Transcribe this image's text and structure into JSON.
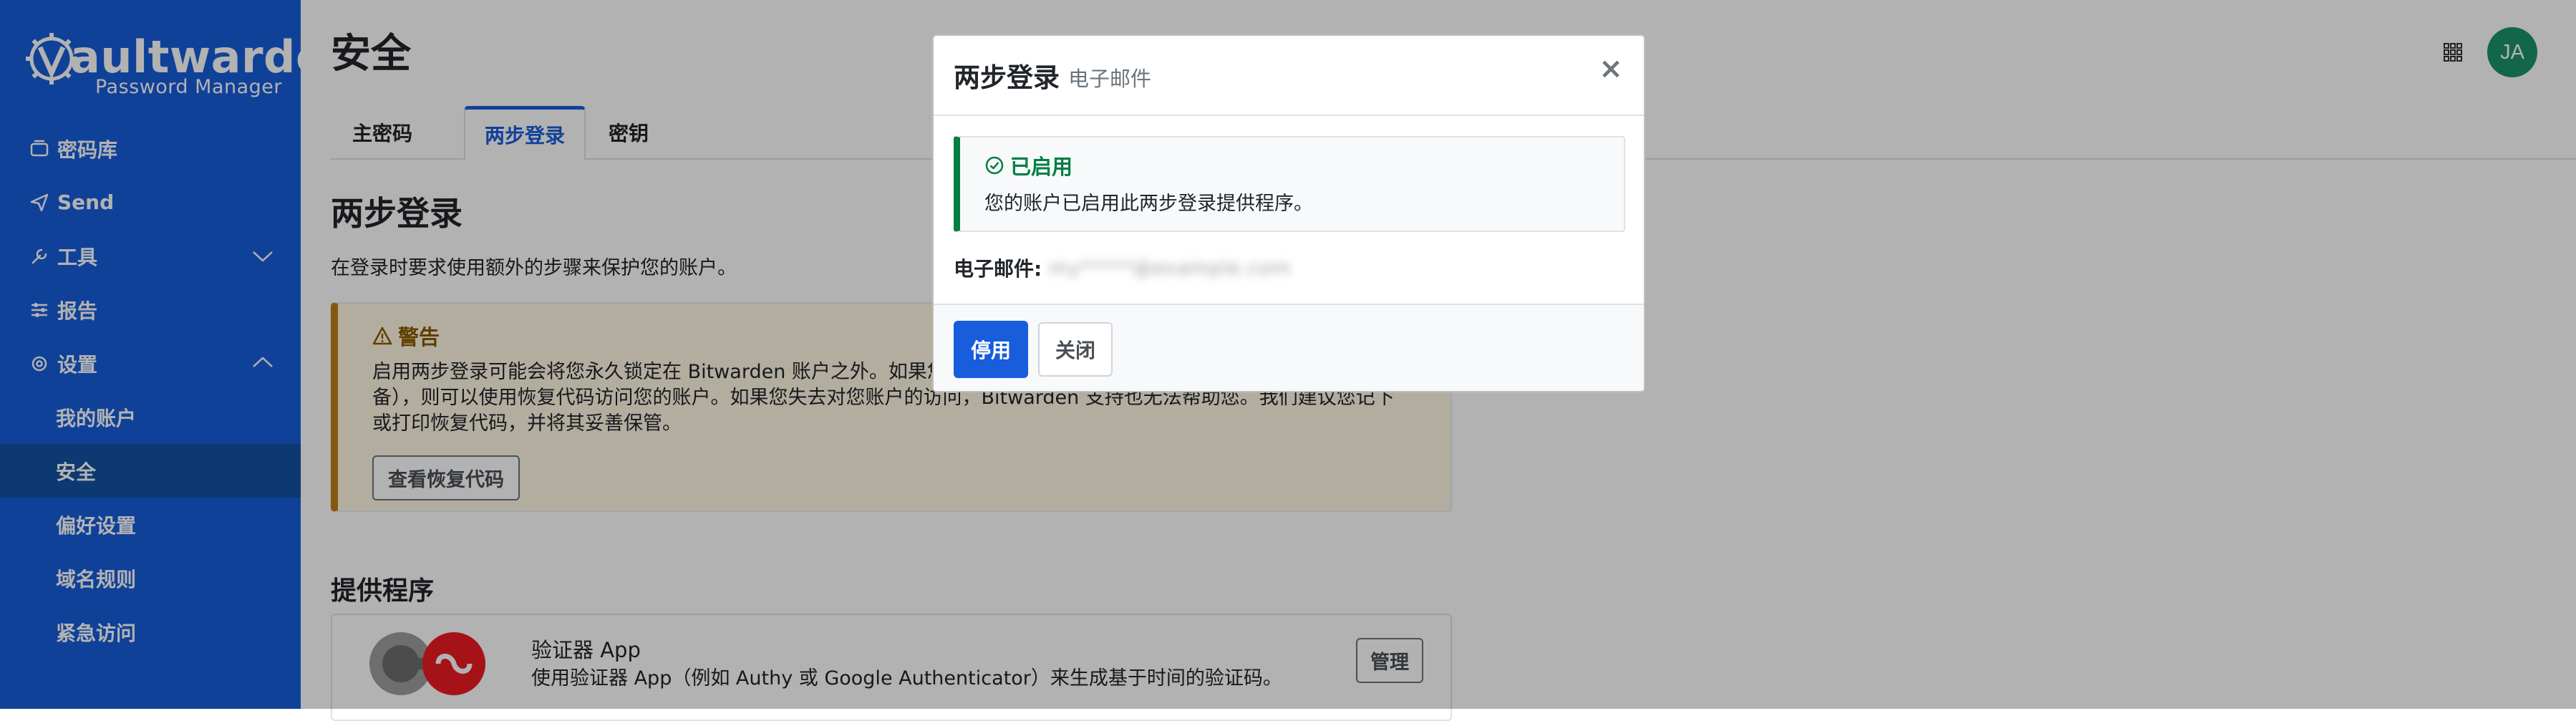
{
  "app": {
    "logo_text_light": "V",
    "logo_text": "aultwarden",
    "logo_subtext": "Password Manager",
    "avatar_initials": "JA",
    "accent_color": "#175ddc",
    "sidebar_color": "#175ddc",
    "avatar_color": "#1a936a"
  },
  "sidebar": {
    "items": [
      {
        "label": "密码库",
        "icon": "vault-icon"
      },
      {
        "label": "Send",
        "icon": "send-icon"
      },
      {
        "label": "工具",
        "icon": "wrench-icon",
        "expanded": false
      },
      {
        "label": "报告",
        "icon": "sliders-icon"
      },
      {
        "label": "设置",
        "icon": "gear-icon",
        "expanded": true
      }
    ],
    "sub_items": [
      {
        "label": "我的账户",
        "active": false
      },
      {
        "label": "安全",
        "active": true
      },
      {
        "label": "偏好设置",
        "active": false
      },
      {
        "label": "域名规则",
        "active": false
      },
      {
        "label": "紧急访问",
        "active": false
      }
    ]
  },
  "main": {
    "page_title": "安全",
    "tabs": [
      {
        "label": "主密码",
        "active": false
      },
      {
        "label": "两步登录",
        "active": true
      },
      {
        "label": "密钥",
        "active": false
      }
    ],
    "section_title": "两步登录",
    "section_desc": "在登录时要求使用额外的步骤来保护您的账户。",
    "warning": {
      "title": "警告",
      "body": "启用两步登录可能会将您永久锁定在 Bitwarden 账户之外。如果您无法使用常规的两步登录提供程序（例如您丢失了设备），则可以使用恢复代码访问您的账户。如果您失去对您账户的访问，Bitwarden 支持也无法帮助您。我们建议您记下或打印恢复代码，并将其妥善保管。",
      "button": "查看恢复代码"
    },
    "providers_title": "提供程序",
    "provider": {
      "name": "验证器 App",
      "desc": "使用验证器 App（例如 Authy 或 Google Authenticator）来生成基于时间的验证码。",
      "button": "管理"
    }
  },
  "modal": {
    "title": "两步登录",
    "subtitle": "电子邮件",
    "close": "×",
    "enabled_title": "已启用",
    "enabled_msg": "您的账户已启用此两步登录提供程序。",
    "email_label": "电子邮件:",
    "email_value": "my*****@example.com",
    "disable_button": "停用",
    "close_button": "关闭",
    "enabled_color": "#017e45"
  }
}
